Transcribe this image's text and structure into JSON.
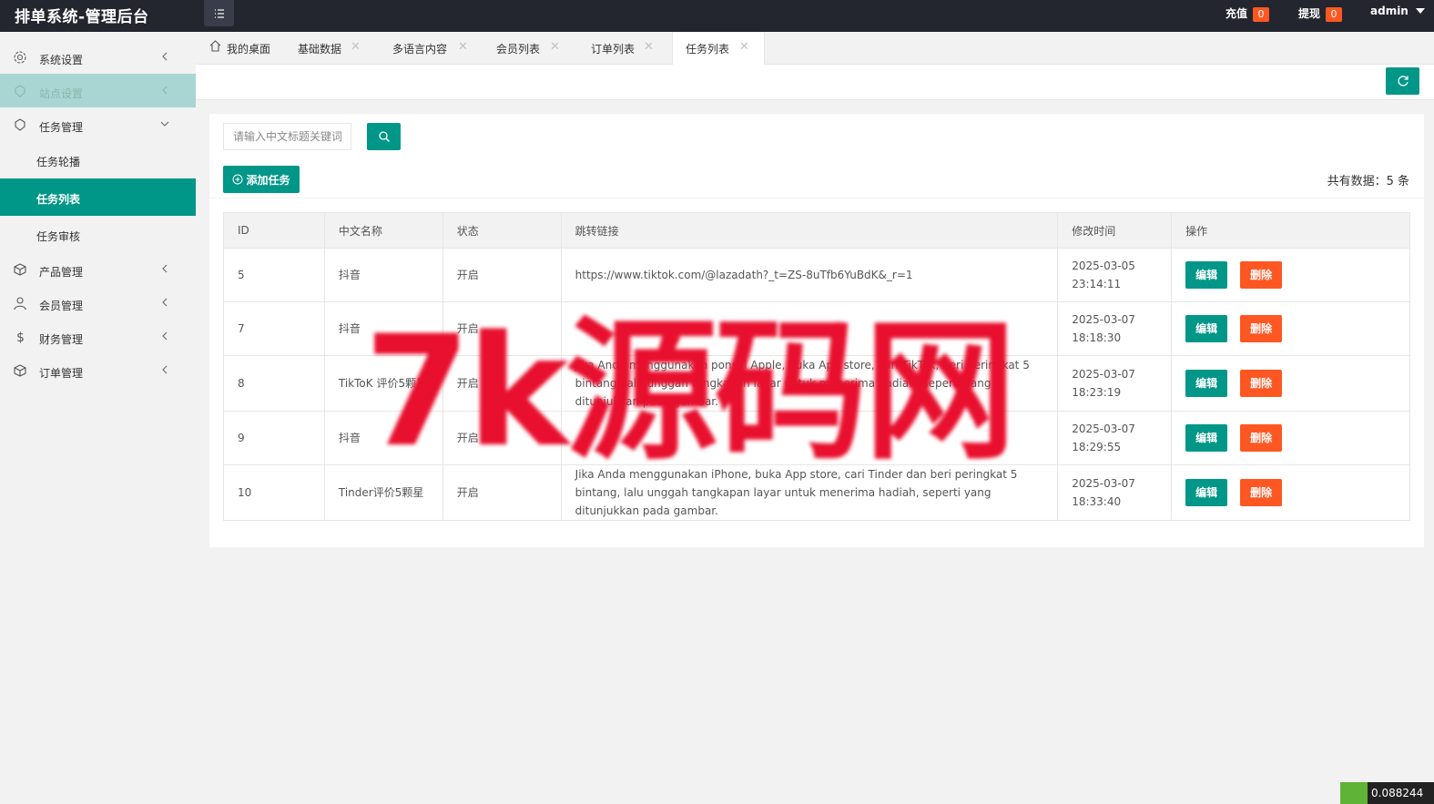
{
  "header": {
    "title": "排单系统-管理后台",
    "recharge_label": "充值",
    "recharge_count": "0",
    "withdraw_label": "提现",
    "withdraw_count": "0",
    "user": "admin"
  },
  "sidebar": {
    "items": [
      {
        "label": "系统设置",
        "icon": "gear-icon"
      },
      {
        "label": "站点设置",
        "icon": "shield-icon"
      },
      {
        "label": "任务管理",
        "icon": "box-icon"
      },
      {
        "label": "产品管理",
        "icon": "cube-icon"
      },
      {
        "label": "会员管理",
        "icon": "user-icon"
      },
      {
        "label": "财务管理",
        "icon": "dollar-icon"
      },
      {
        "label": "订单管理",
        "icon": "cube-icon"
      }
    ],
    "sub_items": [
      {
        "label": "任务轮播"
      },
      {
        "label": "任务列表"
      },
      {
        "label": "任务审核"
      }
    ]
  },
  "tabs": [
    {
      "label": "我的桌面"
    },
    {
      "label": "基础数据"
    },
    {
      "label": "多语言内容"
    },
    {
      "label": "会员列表"
    },
    {
      "label": "订单列表"
    },
    {
      "label": "任务列表"
    }
  ],
  "search": {
    "placeholder": "请输入中文标题关键词"
  },
  "toolbar": {
    "add_label": "添加任务",
    "total_text": "共有数据：5 条"
  },
  "table": {
    "columns": [
      "ID",
      "中文名称",
      "状态",
      "跳转链接",
      "修改时间",
      "操作"
    ],
    "rows": [
      {
        "id": "5",
        "name": "抖音",
        "status": "开启",
        "link": "https://www.tiktok.com/@lazadath?_t=ZS-8uTfb6YuBdK&_r=1",
        "time": "2025-03-05 23:14:11"
      },
      {
        "id": "7",
        "name": "抖音",
        "status": "开启",
        "link": "",
        "time": "2025-03-07 18:18:30"
      },
      {
        "id": "8",
        "name": "TikToK 评价5颗星",
        "status": "开启",
        "link": "Jika Anda menggunakan ponsel Apple, buka App store, cari TikTok, beri peringkat 5 bintang, lalu unggah tangkapan layar untuk menerima hadiah, seperti yang ditunjukkan pada gambar.",
        "time": "2025-03-07 18:23:19"
      },
      {
        "id": "9",
        "name": "抖音",
        "status": "开启",
        "link": "",
        "time": "2025-03-07 18:29:55"
      },
      {
        "id": "10",
        "name": "Tinder评价5颗星",
        "status": "开启",
        "link": "Jika Anda menggunakan iPhone, buka App store, cari Tinder dan beri peringkat 5 bintang, lalu unggah tangkapan layar untuk menerima hadiah, seperti yang ditunjukkan pada gambar.",
        "time": "2025-03-07 18:33:40"
      }
    ],
    "edit_label": "编辑",
    "delete_label": "删除"
  },
  "watermark": "7k源码网",
  "corner_text": "0.088244",
  "colors": {
    "primary": "#009688",
    "danger": "#ff5722",
    "header_bg": "#23262e",
    "disabled": "#a9d6d2"
  }
}
